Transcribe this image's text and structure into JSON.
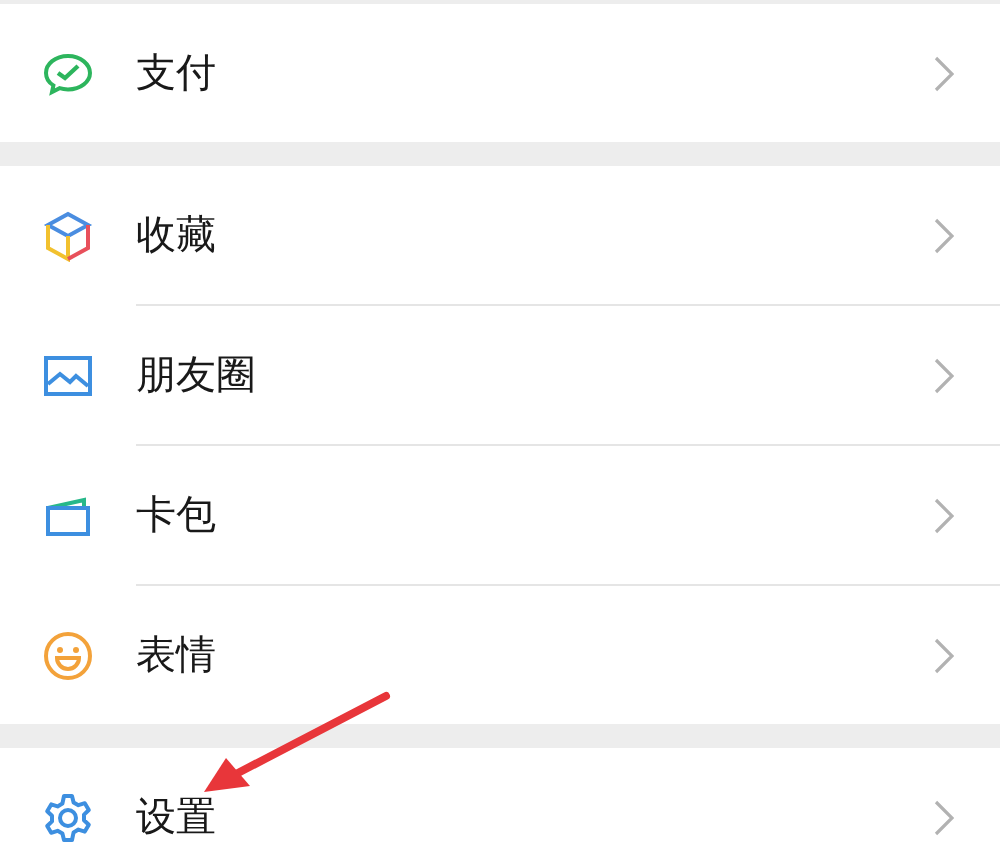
{
  "sections": [
    {
      "items": [
        {
          "label": "支付"
        }
      ]
    },
    {
      "items": [
        {
          "label": "收藏"
        },
        {
          "label": "朋友圈"
        },
        {
          "label": "卡包"
        },
        {
          "label": "表情"
        }
      ]
    },
    {
      "items": [
        {
          "label": "设置"
        }
      ]
    }
  ]
}
